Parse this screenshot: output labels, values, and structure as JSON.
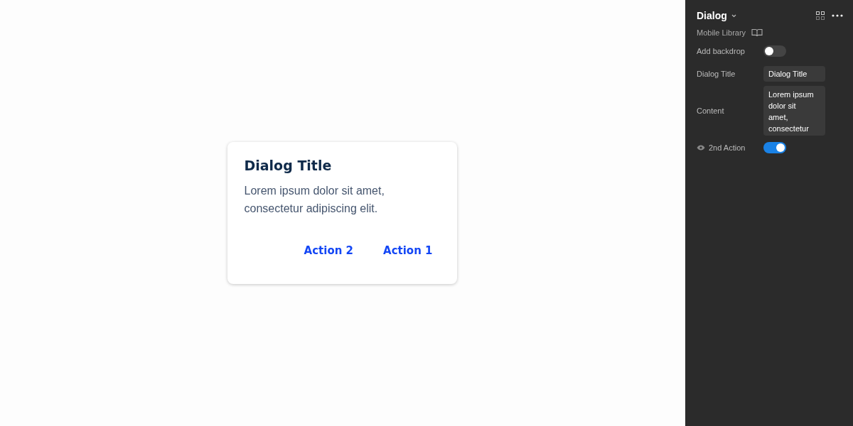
{
  "dialog": {
    "title": "Dialog Title",
    "body": "Lorem ipsum dolor sit amet, consectetur adipiscing elit.",
    "actions": [
      "Action 2",
      "Action 1"
    ]
  },
  "panel": {
    "title": "Dialog",
    "library": "Mobile Library",
    "properties": [
      {
        "kind": "toggle",
        "label": "Add backdrop",
        "on": false
      },
      {
        "kind": "text",
        "label": "Dialog Title",
        "value": "Dialog Title"
      },
      {
        "kind": "textarea",
        "label": "Content",
        "value": "Lorem ipsum dolor sit amet, consectetur"
      },
      {
        "kind": "toggle",
        "label": "2nd Action",
        "on": true,
        "visible_icon": true
      }
    ]
  }
}
